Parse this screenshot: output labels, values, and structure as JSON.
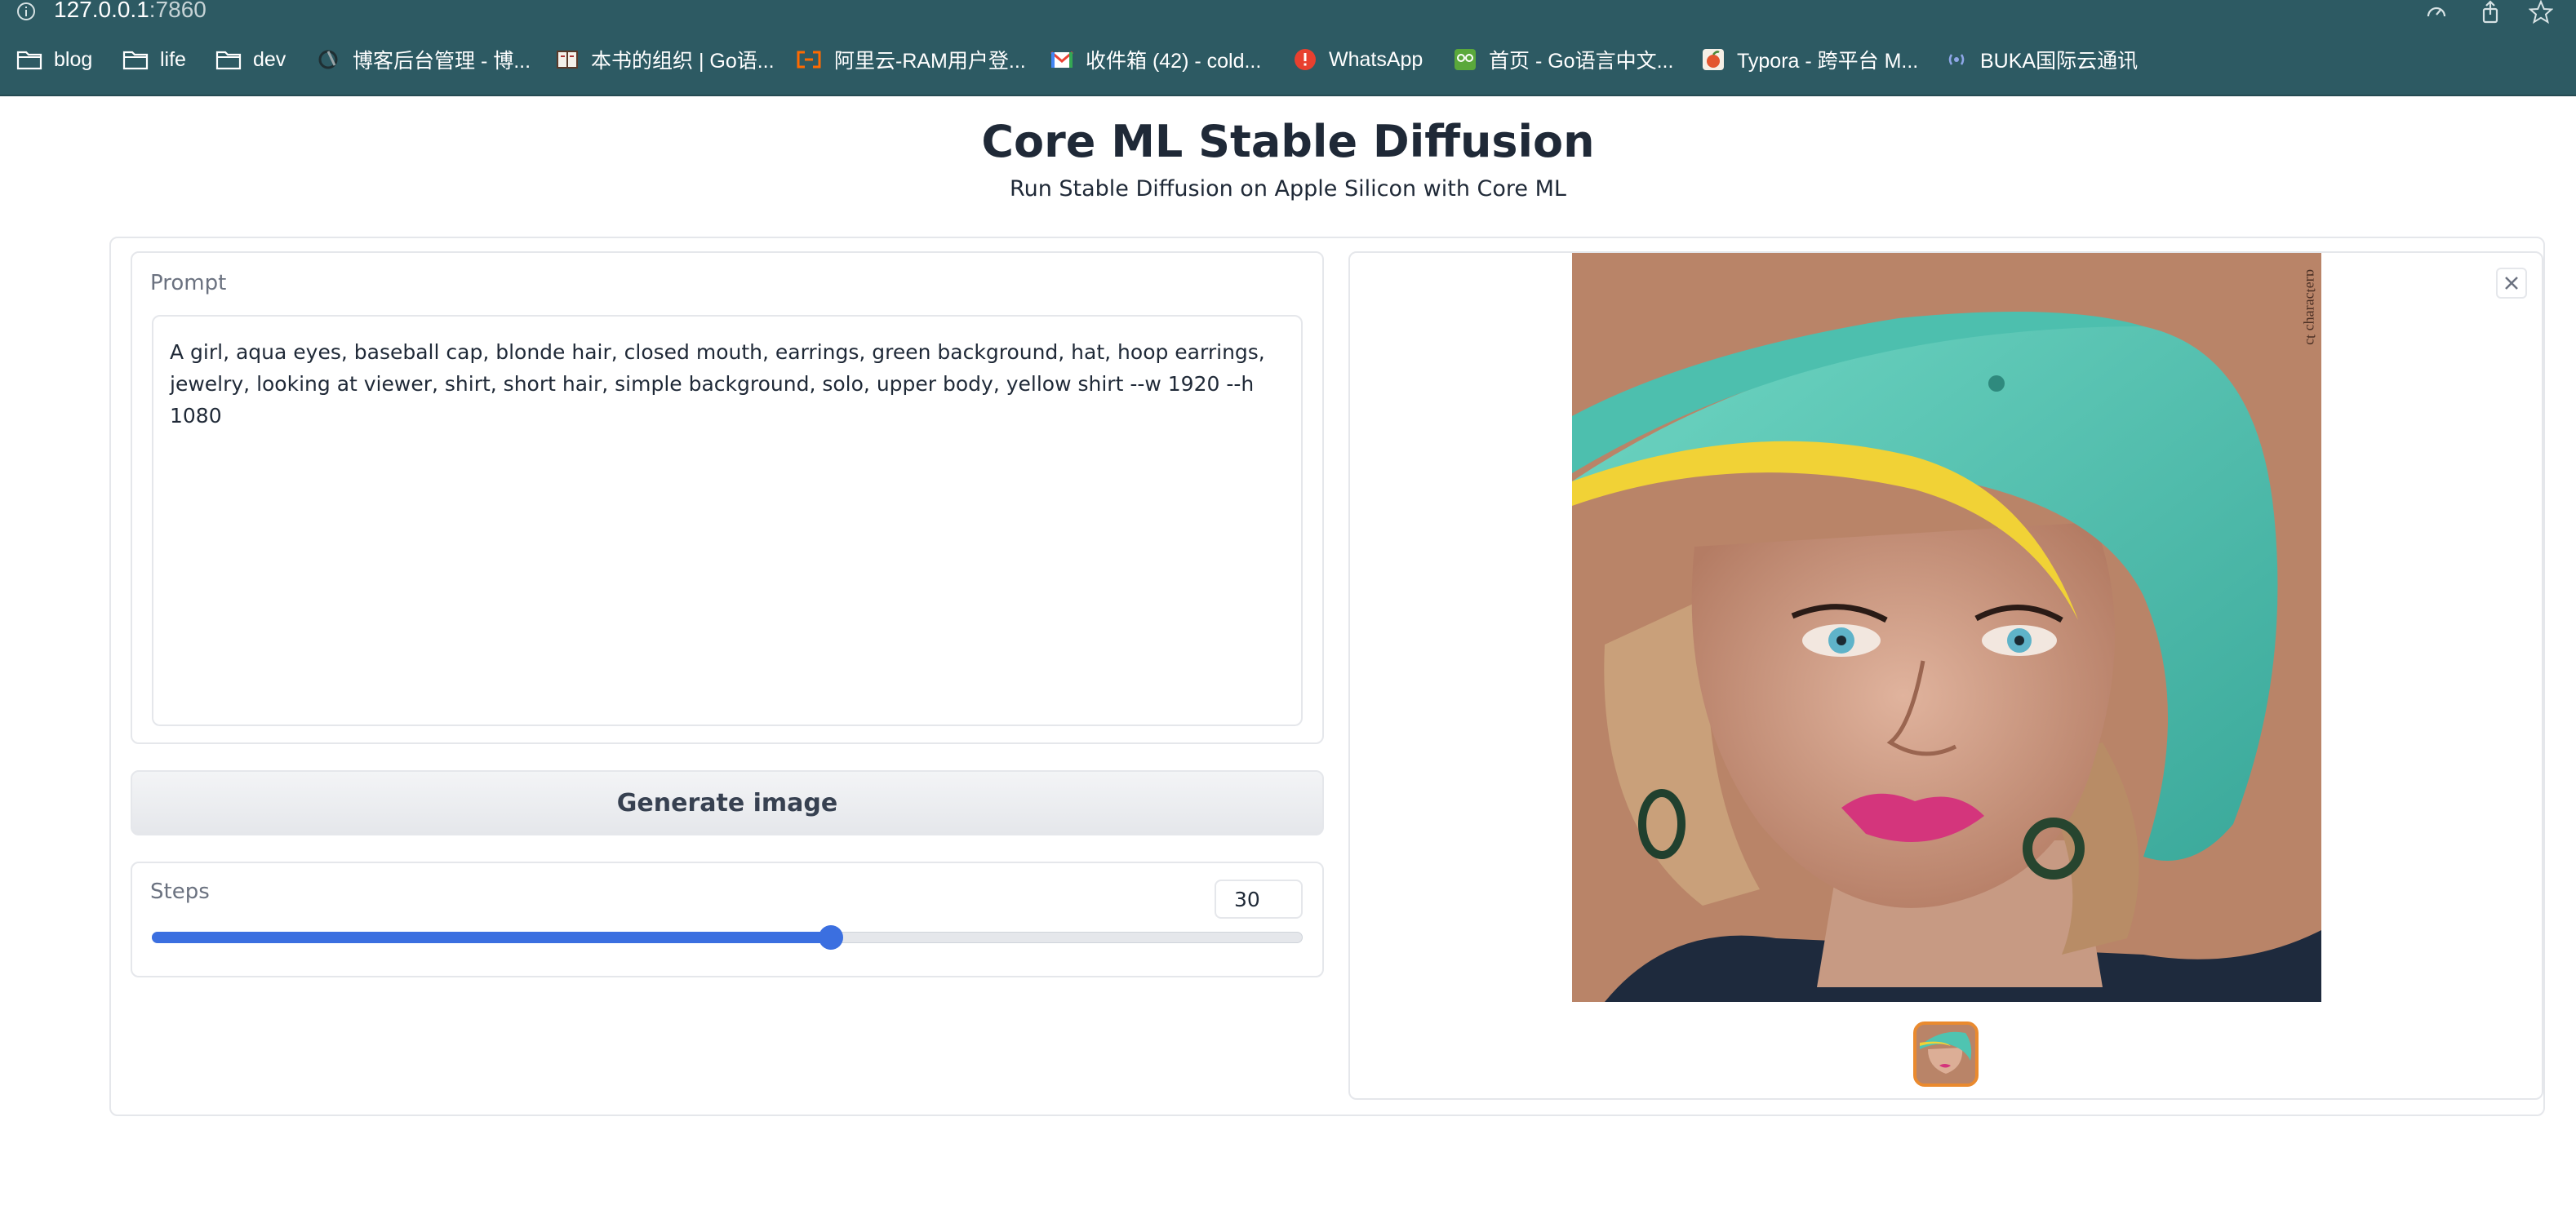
{
  "browser": {
    "url_host": "127.0.0.1",
    "url_port": ":7860",
    "bookmarks": [
      {
        "label": "blog",
        "icon": "folder-icon"
      },
      {
        "label": "life",
        "icon": "folder-icon"
      },
      {
        "label": "dev",
        "icon": "folder-icon"
      },
      {
        "label": "博客后台管理 - 博...",
        "icon": "site-favicon"
      },
      {
        "label": "本书的组织 | Go语...",
        "icon": "book-favicon"
      },
      {
        "label": "阿里云-RAM用户登...",
        "icon": "aliyun-favicon"
      },
      {
        "label": "收件箱 (42) - cold...",
        "icon": "gmail-favicon"
      },
      {
        "label": "WhatsApp",
        "icon": "whatsapp-favicon"
      },
      {
        "label": "首页 - Go语言中文...",
        "icon": "go-favicon"
      },
      {
        "label": "Typora - 跨平台 M...",
        "icon": "typora-favicon"
      },
      {
        "label": "BUKA国际云通讯",
        "icon": "buka-favicon"
      }
    ]
  },
  "page": {
    "title": "Core ML Stable Diffusion",
    "subtitle": "Run Stable Diffusion on Apple Silicon with Core ML"
  },
  "prompt": {
    "label": "Prompt",
    "value": "A girl, aqua eyes, baseball cap, blonde hair, closed mouth, earrings, green background, hat, hoop earrings, jewelry, looking at viewer, shirt, short hair, simple background, solo, upper body, yellow shirt --w 1920 --h 1080"
  },
  "generate_button": {
    "label": "Generate image"
  },
  "steps": {
    "label": "Steps",
    "value": "30",
    "level": 0.59
  },
  "output": {
    "image_icon": "generated-portrait-image",
    "close_icon": "close-icon",
    "thumbnail_icon": "portrait-thumbnail"
  }
}
